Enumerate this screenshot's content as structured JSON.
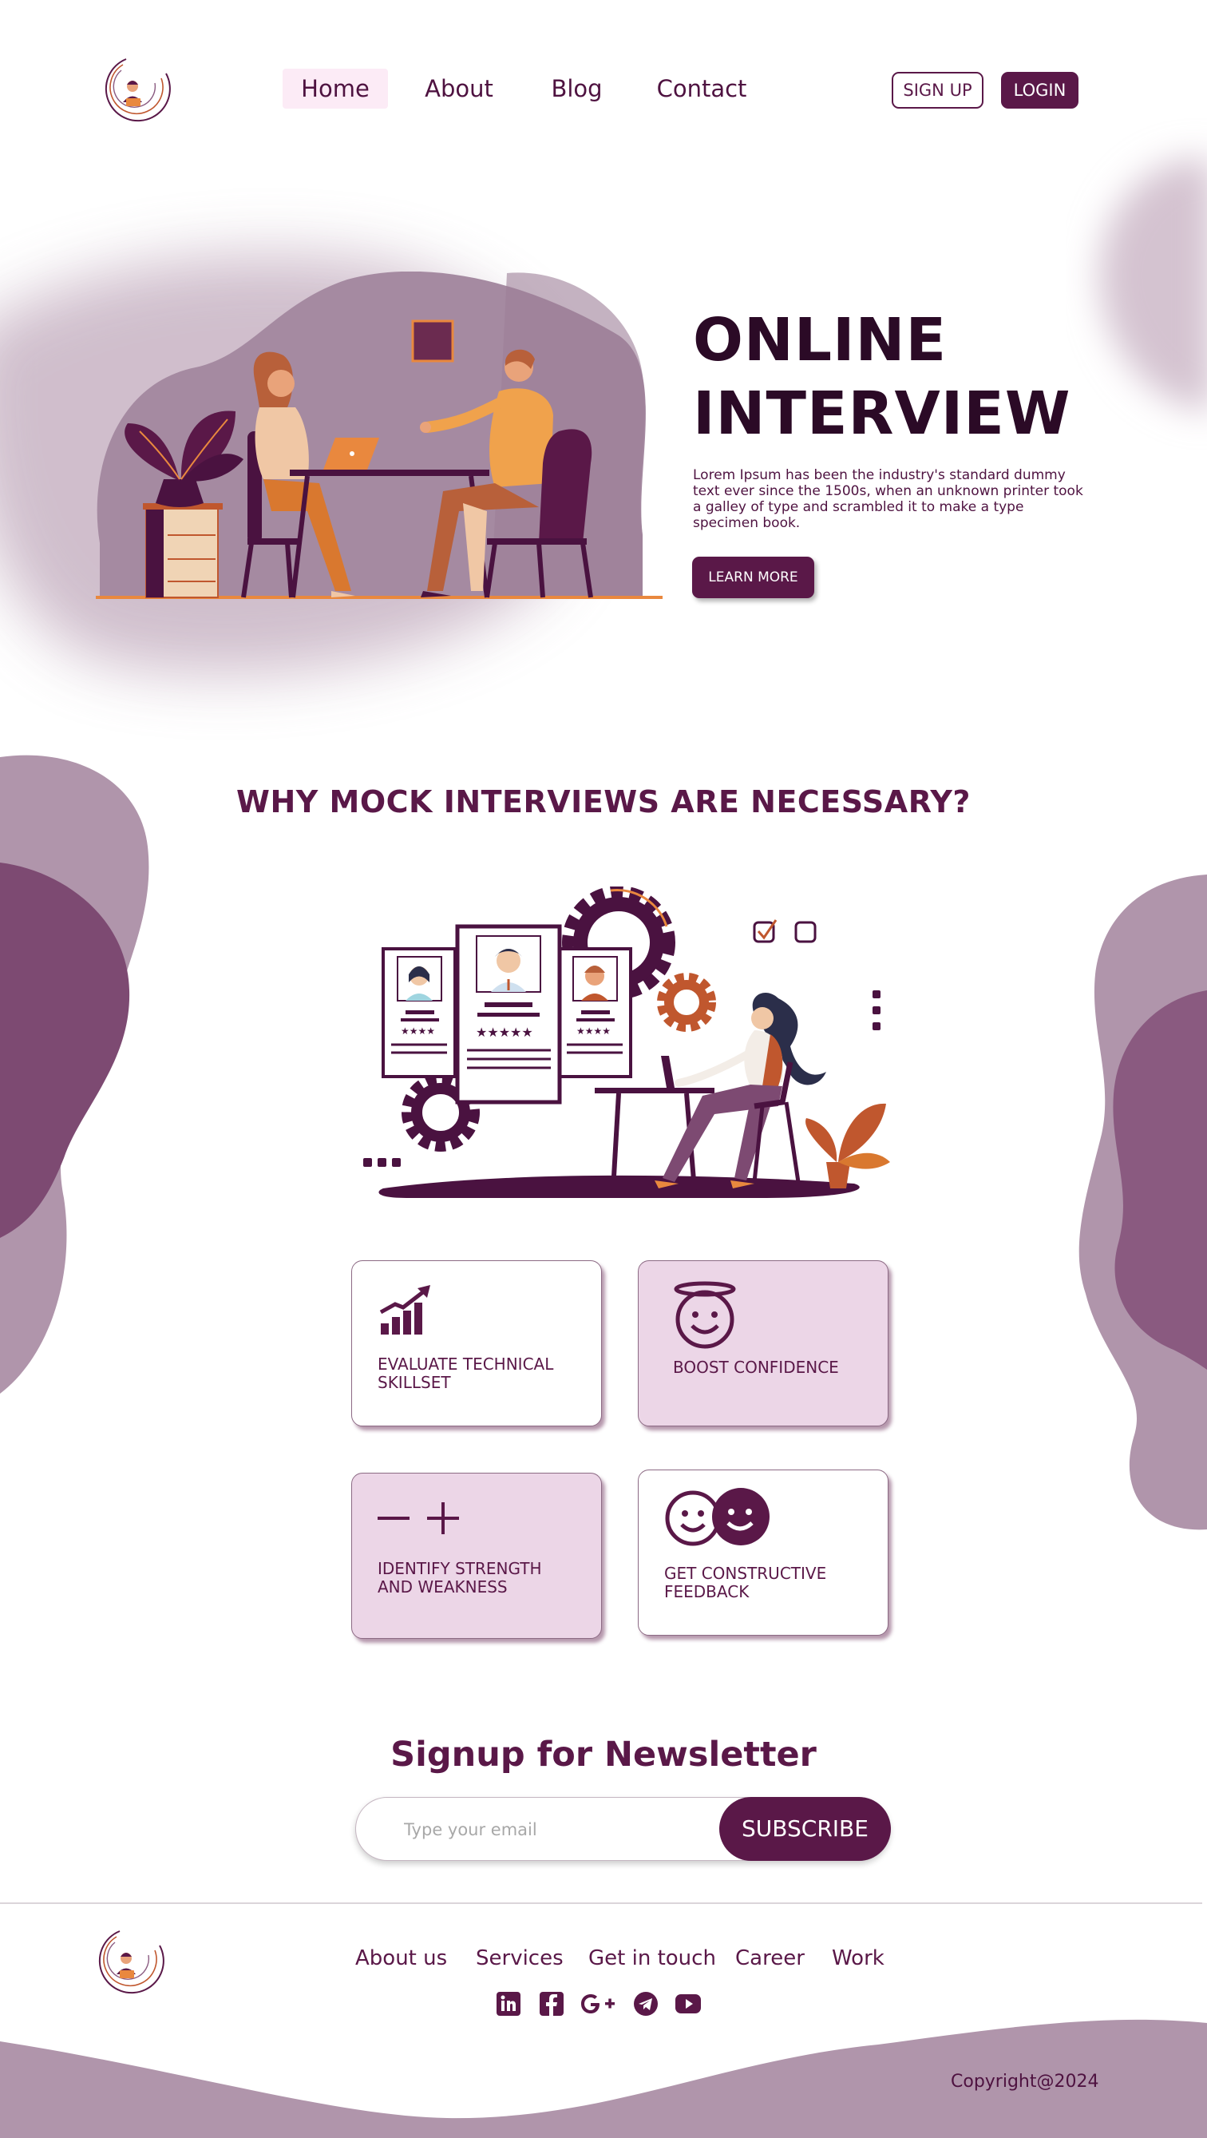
{
  "header": {
    "nav": [
      "Home",
      "About",
      "Blog",
      "Contact"
    ],
    "signup_label": "SIGN UP",
    "login_label": "LOGIN"
  },
  "hero": {
    "title_line1": "ONLINE",
    "title_line2": "INTERVIEW",
    "description": "Lorem Ipsum has been the industry's standard dummy text ever   since the 1500s, when an unknown printer took a galley of type and scrambled it to make a type specimen book.",
    "cta_label": "LEARN MORE"
  },
  "why": {
    "title": "WHY MOCK INTERVIEWS ARE NECESSARY?",
    "cards": [
      {
        "label_line1": "EVALUATE TECHNICAL",
        "label_line2": "SKILLSET",
        "icon": "growth-chart-icon"
      },
      {
        "label_line1": "BOOST CONFIDENCE",
        "label_line2": "",
        "icon": "halo-smiley-icon"
      },
      {
        "label_line1": "IDENTIFY STRENGTH",
        "label_line2": "AND WEAKNESS",
        "icon": "minus-plus-icon"
      },
      {
        "label_line1": "GET CONSTRUCTIVE",
        "label_line2": "FEEDBACK",
        "icon": "two-smileys-icon"
      }
    ]
  },
  "newsletter": {
    "title": "Signup for Newsletter",
    "email_placeholder": "Type your email",
    "subscribe_label": "SUBSCRIBE"
  },
  "footer": {
    "links": [
      "About us",
      "Services",
      "Get in touch",
      "Career",
      "Work"
    ],
    "social": [
      "linkedin-icon",
      "facebook-icon",
      "google-plus-icon",
      "telegram-icon",
      "youtube-icon"
    ],
    "copyright": "Copyright@2024"
  },
  "colors": {
    "primary": "#5a1848",
    "dark": "#2b0a26",
    "blob": "#b497ae",
    "blob_dark": "#8a5a80",
    "card_pink": "#ecd6e7",
    "accent_orange": "#e9883e"
  }
}
